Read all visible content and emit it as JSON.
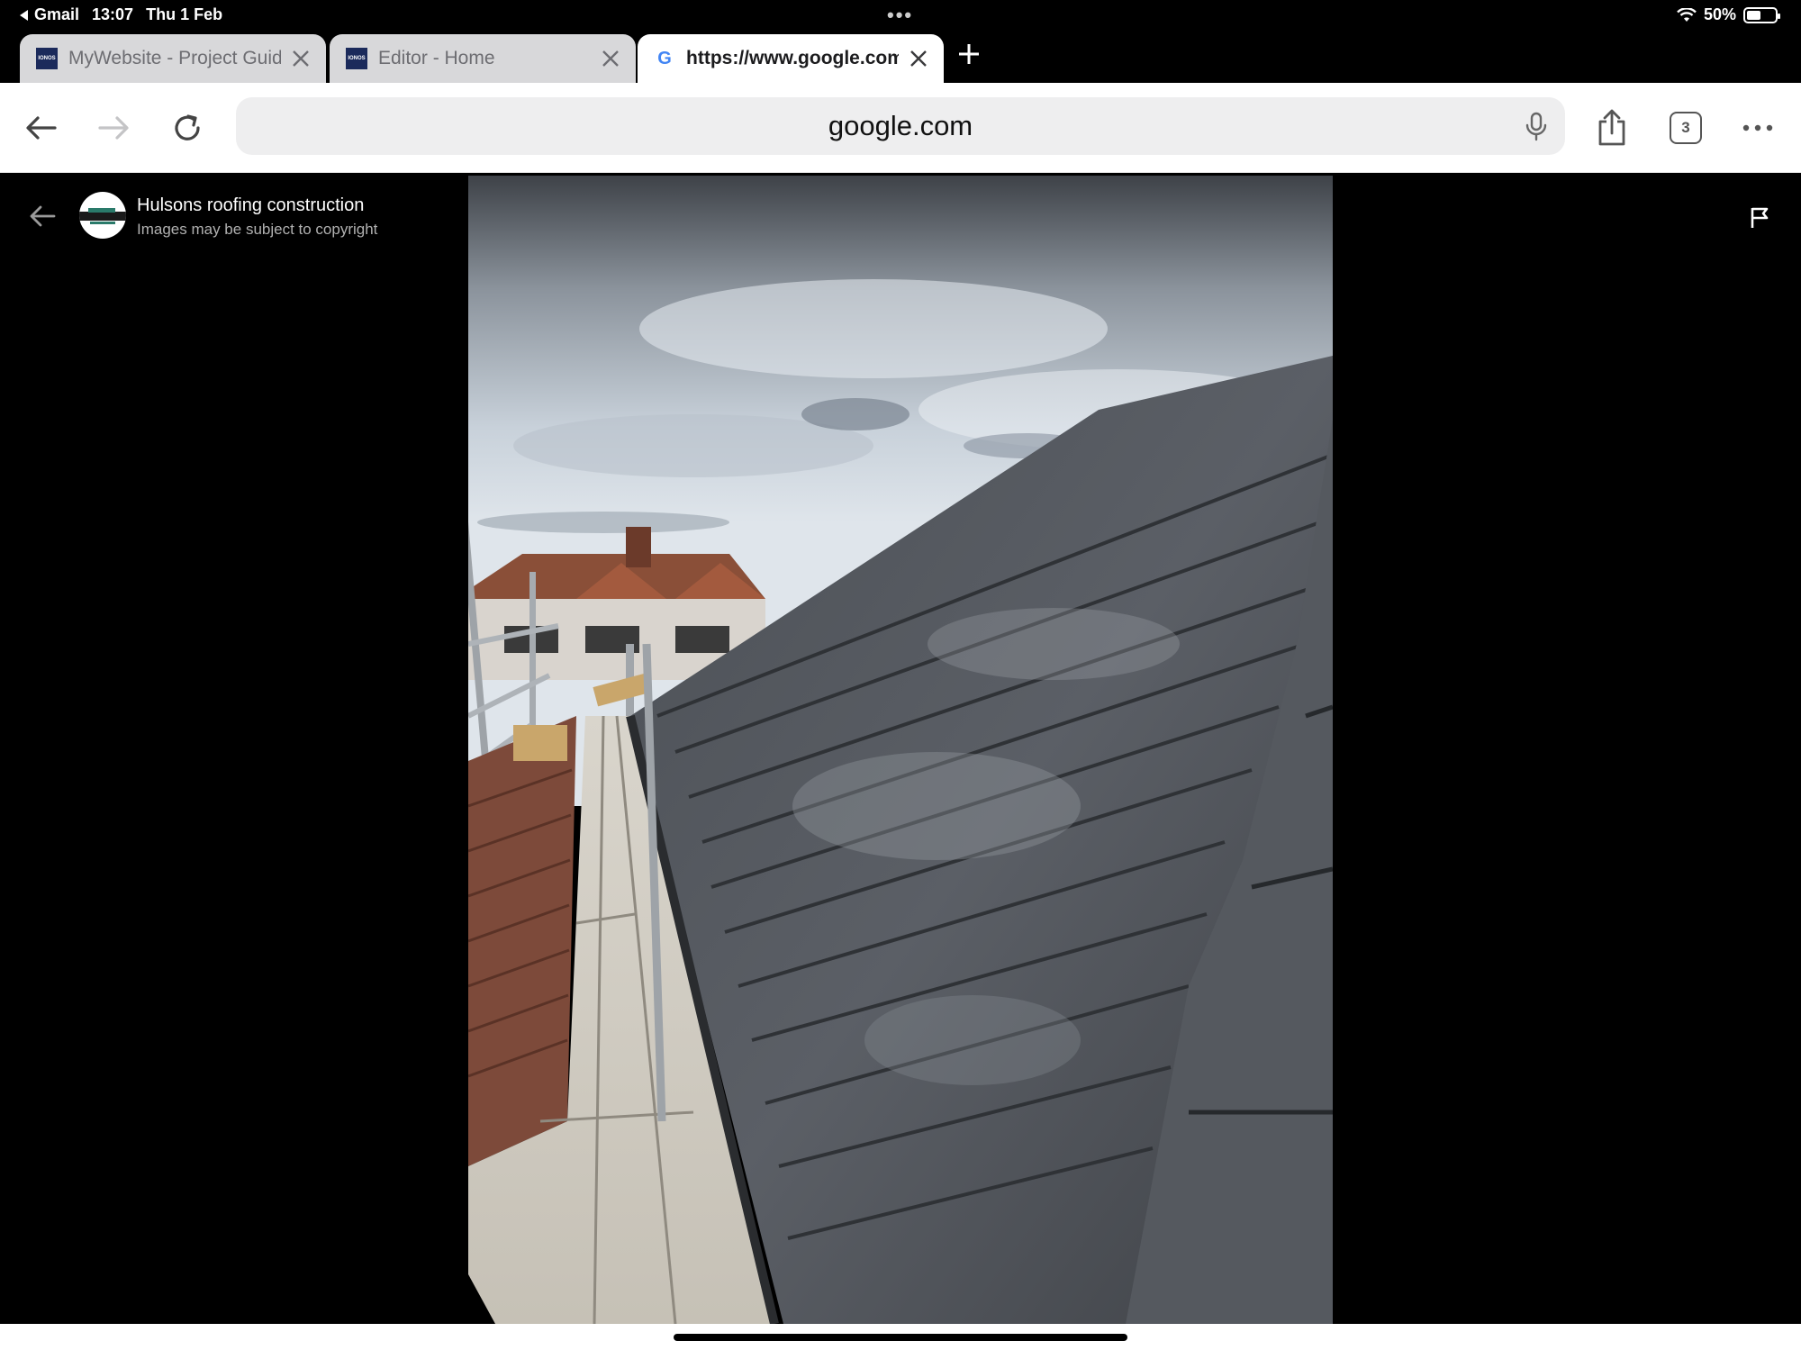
{
  "status_bar": {
    "back_app": "Gmail",
    "time": "13:07",
    "date": "Thu 1 Feb",
    "battery_text": "50%",
    "battery_level": 0.5
  },
  "tabs": [
    {
      "title": "MyWebsite - Project Guid",
      "favicon": "IONOS",
      "active": false
    },
    {
      "title": "Editor - Home",
      "favicon": "IONOS",
      "active": false
    },
    {
      "title": "https://www.google.com/",
      "favicon": "G",
      "active": true
    }
  ],
  "toolbar": {
    "address": "google.com",
    "tab_count": "3"
  },
  "viewer": {
    "source_name": "Hulsons roofing construction",
    "copyright_note": "Images may be subject to copyright"
  },
  "icons": {
    "back": "arrow-left-icon",
    "forward": "arrow-right-icon",
    "reload": "reload-icon",
    "mic": "microphone-icon",
    "share": "share-icon",
    "tabs": "tabs-icon",
    "more": "more-icon",
    "flag": "flag-icon"
  }
}
